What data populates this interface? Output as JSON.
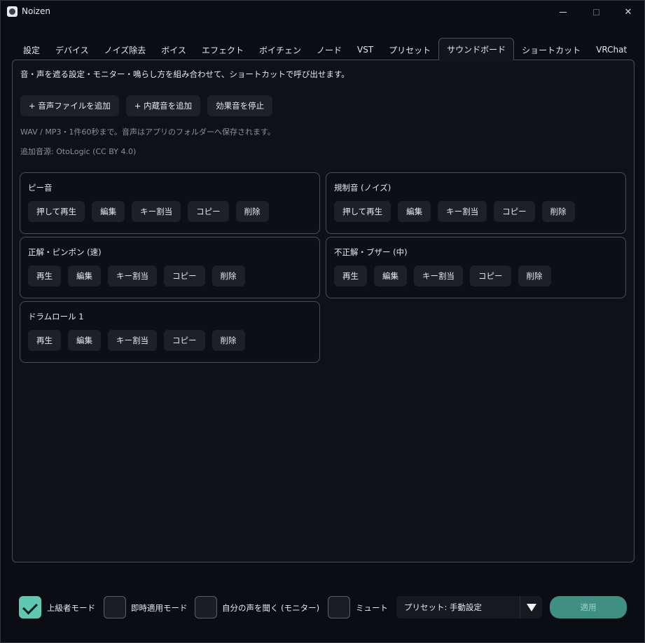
{
  "window": {
    "title": "Noizen"
  },
  "tabs": [
    {
      "label": "設定"
    },
    {
      "label": "デバイス"
    },
    {
      "label": "ノイズ除去"
    },
    {
      "label": "ボイス"
    },
    {
      "label": "エフェクト"
    },
    {
      "label": "ボイチェン"
    },
    {
      "label": "ノード"
    },
    {
      "label": "VST"
    },
    {
      "label": "プリセット"
    },
    {
      "label": "サウンドボード",
      "active": true
    },
    {
      "label": "ショートカット"
    },
    {
      "label": "VRChat"
    }
  ],
  "soundboard": {
    "description": "音・声を遮る設定・モニター・鳴らし方を組み合わせて、ショートカットで呼び出せます。",
    "add_file_label": "+ 音声ファイルを追加",
    "add_builtin_label": "+ 内蔵音を追加",
    "stop_label": "効果音を停止",
    "note_format": "WAV / MP3・1件60秒まで。音声はアプリのフォルダーへ保存されます。",
    "note_credit": "追加音源: OtoLogic (CC BY 4.0)",
    "sounds": [
      {
        "title": "ピー音",
        "play_label": "押して再生",
        "edit_label": "編集",
        "key_label": "キー割当",
        "copy_label": "コピー",
        "delete_label": "削除"
      },
      {
        "title": "規制音 (ノイズ)",
        "play_label": "押して再生",
        "edit_label": "編集",
        "key_label": "キー割当",
        "copy_label": "コピー",
        "delete_label": "削除"
      },
      {
        "title": "正解・ピンポン (速)",
        "play_label": "再生",
        "edit_label": "編集",
        "key_label": "キー割当",
        "copy_label": "コピー",
        "delete_label": "削除"
      },
      {
        "title": "不正解・ブザー (中)",
        "play_label": "再生",
        "edit_label": "編集",
        "key_label": "キー割当",
        "copy_label": "コピー",
        "delete_label": "削除"
      },
      {
        "title": "ドラムロール 1",
        "play_label": "再生",
        "edit_label": "編集",
        "key_label": "キー割当",
        "copy_label": "コピー",
        "delete_label": "削除"
      }
    ]
  },
  "footer": {
    "advanced_mode": {
      "label": "上級者モード",
      "checked": true
    },
    "instant_apply": {
      "label": "即時適用モード",
      "checked": false
    },
    "monitor": {
      "label": "自分の声を聞く (モニター)",
      "checked": false
    },
    "mute": {
      "label": "ミュート",
      "checked": false
    },
    "preset_value": "プリセット: 手動設定",
    "apply_label": "適用"
  },
  "colors": {
    "accent": "#5fc7b2",
    "apply_bg": "#3f8f82",
    "background": "#0c0d12",
    "button_bg": "#1d2029"
  }
}
